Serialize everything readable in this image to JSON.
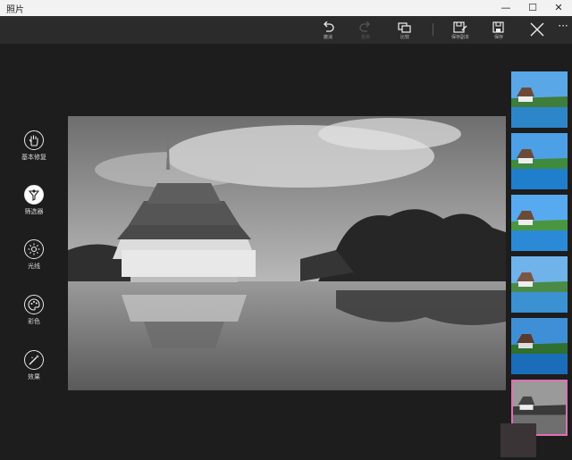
{
  "app": {
    "title": "照片"
  },
  "window": {
    "minimize": "—",
    "maximize": "☐",
    "close": "✕"
  },
  "toolbar": {
    "undo": "撤消",
    "redo": "重做",
    "compare": "比较",
    "save_copy": "保存副本",
    "save": "保存",
    "more": "···"
  },
  "sidebar": {
    "items": [
      {
        "label": "基本修复",
        "icon": "hand-icon"
      },
      {
        "label": "筛选器",
        "icon": "filter-icon"
      },
      {
        "label": "光线",
        "icon": "light-icon"
      },
      {
        "label": "彩色",
        "icon": "palette-icon"
      },
      {
        "label": "效果",
        "icon": "effects-icon"
      }
    ],
    "active_index": 1
  },
  "filters": {
    "count": 6,
    "selected_index": 5,
    "selected_style": "black-and-white"
  },
  "colors": {
    "accent": "#e06fb4",
    "background": "#1d1d1d",
    "toolbar": "#2b2b2b"
  }
}
